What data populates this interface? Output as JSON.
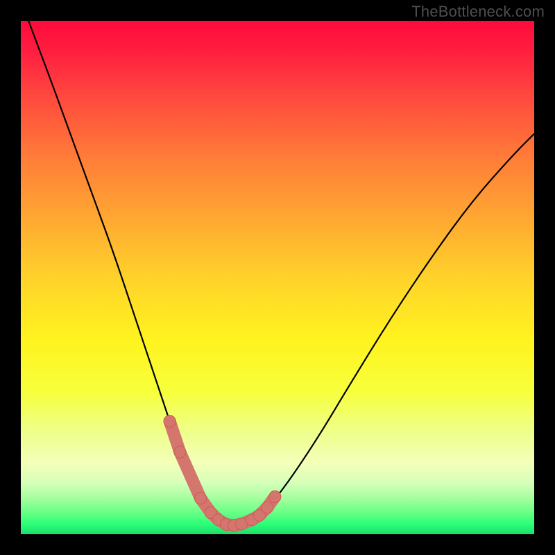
{
  "watermark": {
    "text": "TheBottleneck.com"
  },
  "gradient_colors": {
    "top": "#ff0a3a",
    "mid_upper": "#ff7a38",
    "mid": "#ffd22a",
    "mid_lower": "#fff31f",
    "lower": "#a4ff9e",
    "bottom": "#1bde6a"
  },
  "curve_style": {
    "stroke": "#000000",
    "stroke_width": 2.2,
    "segment_color": "#d5766e",
    "segment_radius": 9,
    "segment_stroke": "#c95c55"
  },
  "chart_data": {
    "type": "line",
    "title": "",
    "xlabel": "",
    "ylabel": "",
    "xlim": [
      0,
      100
    ],
    "ylim": [
      0,
      100
    ],
    "x": [
      0,
      3,
      6,
      10,
      14,
      18,
      22,
      26,
      29,
      31,
      33,
      35,
      37,
      38.5,
      40,
      41.5,
      43,
      45,
      48,
      52,
      58,
      64,
      72,
      80,
      88,
      96,
      100
    ],
    "y": [
      104,
      96,
      88,
      77,
      66,
      55,
      43,
      31,
      22,
      16,
      11,
      7,
      4,
      2.5,
      1.8,
      1.6,
      1.8,
      2.6,
      5,
      10,
      19,
      29,
      42,
      54,
      65,
      74,
      78
    ],
    "highlight_segments_x": [
      29,
      31,
      35,
      37,
      38.5,
      40,
      41.5,
      43,
      45,
      46.5,
      48,
      49.5
    ],
    "highlight_segments_y": [
      22,
      16,
      7,
      4.2,
      2.8,
      1.9,
      1.7,
      2.0,
      2.8,
      3.7,
      5.2,
      7.3
    ],
    "notes": "V-shaped bottleneck curve; y is bottleneck magnitude (lower is better, green zone). Highlight segments are the pink/salmon sausage-link markers near the valley floor."
  }
}
